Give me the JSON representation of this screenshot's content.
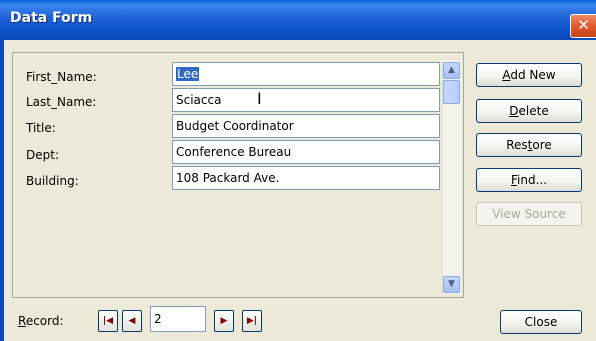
{
  "window": {
    "title": "Data Form",
    "close_glyph": "✕"
  },
  "fields": [
    {
      "label": "First_Name:",
      "value": "Lee"
    },
    {
      "label": "Last_Name:",
      "value": "Sciacca"
    },
    {
      "label": "Title:",
      "value": "Budget Coordinator"
    },
    {
      "label": "Dept:",
      "value": "Conference Bureau"
    },
    {
      "label": "Building:",
      "value": "108 Packard Ave."
    }
  ],
  "buttons": {
    "add_new": {
      "mnemonic": "A",
      "rest": "dd New"
    },
    "delete": {
      "mnemonic": "D",
      "rest": "elete"
    },
    "restore_pre": "Res",
    "restore_mnemonic": "t",
    "restore_post": "ore",
    "find": {
      "mnemonic": "F",
      "rest": "ind..."
    },
    "view_source": "View Source",
    "close": "Close"
  },
  "record": {
    "label_mnemonic": "R",
    "label_rest": "ecord:",
    "value": "2"
  },
  "scrollbar": {
    "up_glyph": "▲",
    "down_glyph": "▼"
  },
  "nav_glyphs": {
    "first": "|◀",
    "prev": "◀",
    "next": "▶",
    "last": "▶|"
  },
  "colors": {
    "titlebar": "#1f62d6",
    "selection": "#316ac5",
    "dialog_bg": "#ece9d8"
  }
}
